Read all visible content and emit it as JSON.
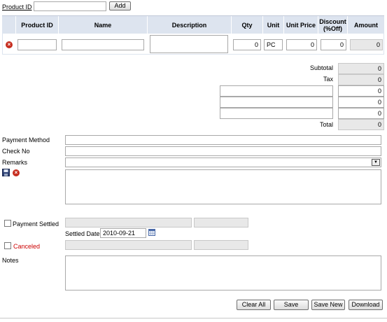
{
  "top": {
    "product_id_label": "Product ID",
    "product_id_value": "",
    "add_button": "Add"
  },
  "table": {
    "headers": [
      "Product ID",
      "Name",
      "Description",
      "Qty",
      "Unit",
      "Unit Price",
      "Discount (%Off)",
      "Amount"
    ],
    "row": {
      "product_id": "",
      "name": "",
      "description": "",
      "qty": "0",
      "unit": "PC",
      "unit_price": "0",
      "discount": "0",
      "amount": "0"
    }
  },
  "totals": {
    "subtotal_label": "Subtotal",
    "subtotal": "0",
    "tax_label": "Tax",
    "tax": "0",
    "extra": [
      {
        "name": "",
        "value": "0"
      },
      {
        "name": "",
        "value": "0"
      },
      {
        "name": "",
        "value": "0"
      }
    ],
    "total_label": "Total",
    "total": "0"
  },
  "payment": {
    "method_label": "Payment Method",
    "method_value": "",
    "check_label": "Check No",
    "check_value": "",
    "remarks_label": "Remarks",
    "remarks_value": "",
    "remarks_text": ""
  },
  "settled": {
    "label": "Payment Settled",
    "field1": "",
    "field2": "",
    "date_label": "Settled Date:",
    "date_value": "2010-09-21"
  },
  "canceled": {
    "label": "Canceled",
    "field1": "",
    "field2": "",
    "color": "#cc0000"
  },
  "notes": {
    "label": "Notes",
    "value": ""
  },
  "buttons": {
    "clear": "Clear All",
    "save": "Save",
    "save_new": "Save New",
    "download": "Download"
  },
  "colors": {
    "header_bg": "#dde4ef",
    "delete_icon": "#c62d1f"
  }
}
